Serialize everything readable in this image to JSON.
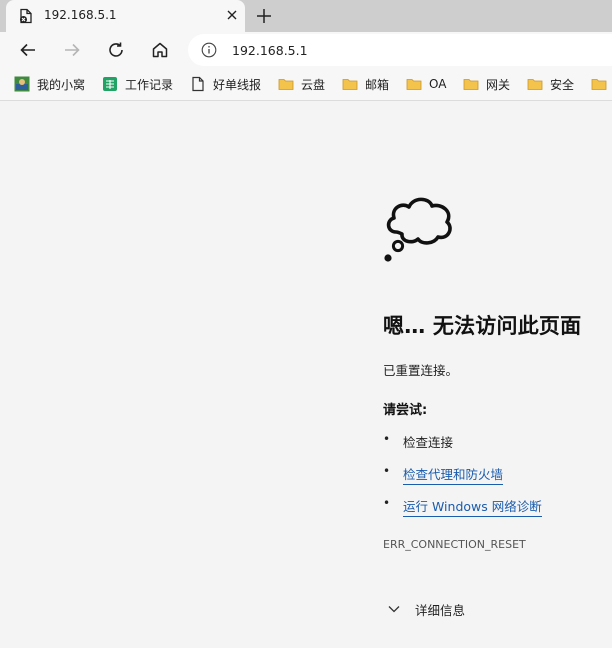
{
  "tab": {
    "title": "192.168.5.1",
    "favicon": "broken-page-icon"
  },
  "toolbar": {
    "back": "back-arrow-icon",
    "forward": "forward-arrow-icon",
    "refresh": "refresh-icon",
    "home": "home-icon"
  },
  "address": {
    "url": "192.168.5.1",
    "icon": "info-icon"
  },
  "bookmarks": {
    "items": [
      {
        "label": "我的小窝",
        "icon": "site-favicon"
      },
      {
        "label": "工作记录",
        "icon": "sheet-icon"
      },
      {
        "label": "好单线报",
        "icon": "page-icon"
      },
      {
        "label": "云盘",
        "icon": "folder-icon"
      },
      {
        "label": "邮箱",
        "icon": "folder-icon"
      },
      {
        "label": "OA",
        "icon": "folder-icon"
      },
      {
        "label": "网关",
        "icon": "folder-icon"
      },
      {
        "label": "安全",
        "icon": "folder-icon"
      }
    ]
  },
  "error": {
    "title": "嗯… 无法访问此页面",
    "subtitle": "已重置连接。",
    "try_heading": "请尝试:",
    "suggestions": [
      "检查连接",
      "检查代理和防火墙",
      "运行 Windows 网络诊断"
    ],
    "code": "ERR_CONNECTION_RESET",
    "details_label": "详细信息"
  },
  "colors": {
    "link": "#1a5cad",
    "folder": "#f3c34b",
    "tabstrip": "#cecece",
    "page_bg": "#f4f4f4"
  }
}
